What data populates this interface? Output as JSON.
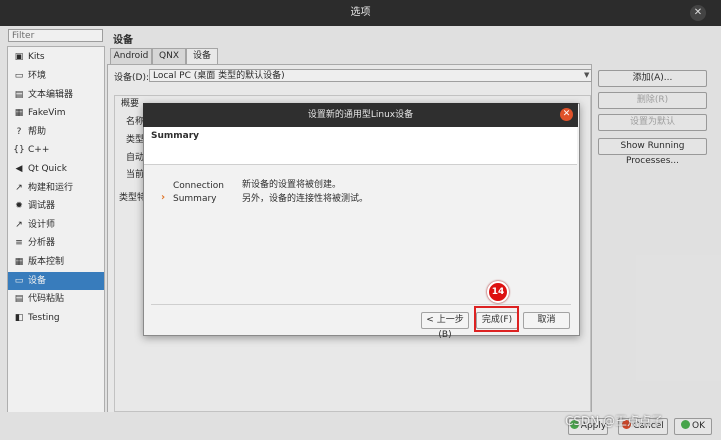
{
  "window": {
    "title": "选项",
    "close_glyph": "✕"
  },
  "filter": {
    "placeholder": "Filter"
  },
  "sidebar": {
    "items": [
      {
        "icon": "▣",
        "icon_name": "kits-icon",
        "label": "Kits"
      },
      {
        "icon": "▭",
        "icon_name": "monitor-icon",
        "label": "环境"
      },
      {
        "icon": "▤",
        "icon_name": "text-editor-icon",
        "label": "文本编辑器"
      },
      {
        "icon": "▦",
        "icon_name": "fakevim-icon",
        "label": "FakeVim"
      },
      {
        "icon": "?",
        "icon_name": "help-icon",
        "label": "帮助"
      },
      {
        "icon": "{}",
        "icon_name": "cpp-icon",
        "label": "C++"
      },
      {
        "icon": "◀",
        "icon_name": "qtquick-icon",
        "label": "Qt Quick"
      },
      {
        "icon": "↗",
        "icon_name": "build-run-icon",
        "label": "构建和运行"
      },
      {
        "icon": "✹",
        "icon_name": "debugger-icon",
        "label": "调试器"
      },
      {
        "icon": "↗",
        "icon_name": "designer-icon",
        "label": "设计师"
      },
      {
        "icon": "≡",
        "icon_name": "analyzer-icon",
        "label": "分析器"
      },
      {
        "icon": "▦",
        "icon_name": "version-control-icon",
        "label": "版本控制"
      },
      {
        "icon": "▭",
        "icon_name": "devices-icon",
        "label": "设备",
        "selected": true
      },
      {
        "icon": "▤",
        "icon_name": "code-paste-icon",
        "label": "代码粘贴"
      },
      {
        "icon": "◧",
        "icon_name": "testing-icon",
        "label": "Testing"
      }
    ]
  },
  "page": {
    "title": "设备"
  },
  "tabs": [
    "Android",
    "QNX",
    "设备"
  ],
  "device": {
    "label": "设备(D):",
    "value": "Local PC (桌面 类型的默认设备)",
    "overview_label": "概要",
    "overview_rows": [
      "名称",
      "类型",
      "自动",
      "当前"
    ],
    "type_specific": "类型特"
  },
  "right_buttons": [
    {
      "label": "添加(A)...",
      "enabled": true
    },
    {
      "label": "删除(R)",
      "enabled": false
    },
    {
      "label": "设置为默认",
      "enabled": false
    },
    {
      "label": "Show Running Processes...",
      "enabled": true
    }
  ],
  "bottom_buttons": {
    "apply": "Apply",
    "cancel": "Cancel",
    "ok": "OK"
  },
  "watermark": "CSDN @王点点子",
  "dialog": {
    "title": "设置新的通用型Linux设备",
    "close_glyph": "✕",
    "header": "Summary",
    "steps": [
      "Connection",
      "Summary"
    ],
    "current_step_marker": "›",
    "text_line1": "新设备的设置将被创建。",
    "text_line2": "另外，设备的连接性将被测试。",
    "back_label": "< 上一步(B)",
    "finish_label": "完成(F)",
    "cancel_label": "取消"
  },
  "annotation": {
    "badge": "14",
    "color": "#dd1111"
  },
  "colors": {
    "selection": "#3c84c8",
    "titlebar": "#2c2c2c",
    "dialog_close": "#e0522a"
  }
}
